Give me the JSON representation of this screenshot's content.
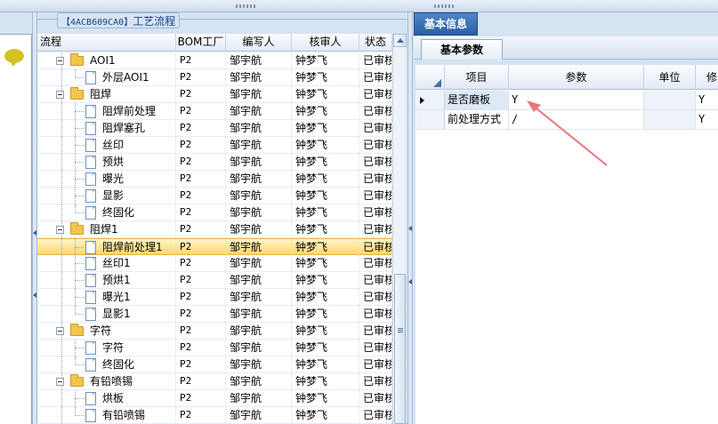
{
  "group": {
    "code": "【4ACB609CA0】",
    "title": "工艺流程"
  },
  "tree_grid": {
    "columns": [
      "流程",
      "BOM工厂",
      "编写人",
      "核审人",
      "状态"
    ],
    "rows": [
      {
        "name": "AOI1",
        "level": 1,
        "type": "folder",
        "factory": "P2",
        "writer": "邹宇航",
        "reviewer": "钟梦飞",
        "status": "已审核"
      },
      {
        "name": "外层AOI1",
        "level": 2,
        "type": "doc",
        "factory": "P2",
        "writer": "邹宇航",
        "reviewer": "钟梦飞",
        "status": "已审核"
      },
      {
        "name": "阻焊",
        "level": 1,
        "type": "folder",
        "factory": "P2",
        "writer": "邹宇航",
        "reviewer": "钟梦飞",
        "status": "已审核"
      },
      {
        "name": "阻焊前处理",
        "level": 2,
        "type": "doc",
        "factory": "P2",
        "writer": "邹宇航",
        "reviewer": "钟梦飞",
        "status": "已审核"
      },
      {
        "name": "阻焊塞孔",
        "level": 2,
        "type": "doc",
        "factory": "P2",
        "writer": "邹宇航",
        "reviewer": "钟梦飞",
        "status": "已审核"
      },
      {
        "name": "丝印",
        "level": 2,
        "type": "doc",
        "factory": "P2",
        "writer": "邹宇航",
        "reviewer": "钟梦飞",
        "status": "已审核"
      },
      {
        "name": "预烘",
        "level": 2,
        "type": "doc",
        "factory": "P2",
        "writer": "邹宇航",
        "reviewer": "钟梦飞",
        "status": "已审核"
      },
      {
        "name": "曝光",
        "level": 2,
        "type": "doc",
        "factory": "P2",
        "writer": "邹宇航",
        "reviewer": "钟梦飞",
        "status": "已审核"
      },
      {
        "name": "显影",
        "level": 2,
        "type": "doc",
        "factory": "P2",
        "writer": "邹宇航",
        "reviewer": "钟梦飞",
        "status": "已审核"
      },
      {
        "name": "终固化",
        "level": 2,
        "type": "doc",
        "factory": "P2",
        "writer": "邹宇航",
        "reviewer": "钟梦飞",
        "status": "已审核"
      },
      {
        "name": "阻焊1",
        "level": 1,
        "type": "folder",
        "factory": "P2",
        "writer": "邹宇航",
        "reviewer": "钟梦飞",
        "status": "已审核"
      },
      {
        "name": "阻焊前处理1",
        "level": 2,
        "type": "doc",
        "factory": "P2",
        "writer": "邹宇航",
        "reviewer": "钟梦飞",
        "status": "已审核",
        "selected": true
      },
      {
        "name": "丝印1",
        "level": 2,
        "type": "doc",
        "factory": "P2",
        "writer": "邹宇航",
        "reviewer": "钟梦飞",
        "status": "已审核"
      },
      {
        "name": "预烘1",
        "level": 2,
        "type": "doc",
        "factory": "P2",
        "writer": "邹宇航",
        "reviewer": "钟梦飞",
        "status": "已审核"
      },
      {
        "name": "曝光1",
        "level": 2,
        "type": "doc",
        "factory": "P2",
        "writer": "邹宇航",
        "reviewer": "钟梦飞",
        "status": "已审核"
      },
      {
        "name": "显影1",
        "level": 2,
        "type": "doc",
        "factory": "P2",
        "writer": "邹宇航",
        "reviewer": "钟梦飞",
        "status": "已审核"
      },
      {
        "name": "字符",
        "level": 1,
        "type": "folder",
        "factory": "P2",
        "writer": "邹宇航",
        "reviewer": "钟梦飞",
        "status": "已审核"
      },
      {
        "name": "字符",
        "level": 2,
        "type": "doc",
        "factory": "P2",
        "writer": "邹宇航",
        "reviewer": "钟梦飞",
        "status": "已审核"
      },
      {
        "name": "终固化",
        "level": 2,
        "type": "doc",
        "factory": "P2",
        "writer": "邹宇航",
        "reviewer": "钟梦飞",
        "status": "已审核"
      },
      {
        "name": "有铅喷锡",
        "level": 1,
        "type": "folder",
        "factory": "P2",
        "writer": "邹宇航",
        "reviewer": "钟梦飞",
        "status": "已审核"
      },
      {
        "name": "烘板",
        "level": 2,
        "type": "doc",
        "factory": "P2",
        "writer": "邹宇航",
        "reviewer": "钟梦飞",
        "status": "已审核"
      },
      {
        "name": "有铅喷锡",
        "level": 2,
        "type": "doc",
        "factory": "P2",
        "writer": "邹宇航",
        "reviewer": "钟梦飞",
        "status": "已审核"
      }
    ]
  },
  "right_panel": {
    "tab_label": "基本信息",
    "subtab_label": "基本参数",
    "columns": [
      "项目",
      "参数",
      "单位",
      "修"
    ],
    "rows": [
      {
        "item": "是否磨板",
        "param": "Y",
        "unit": "",
        "flag": "Y",
        "current": true
      },
      {
        "item": "前处理方式",
        "param": "/",
        "unit": "",
        "flag": "Y",
        "current": false
      }
    ]
  },
  "colors": {
    "accent": "#2a5ea6",
    "selection": "#ffd86e",
    "annotation_arrow": "#e8767a",
    "chat_icon": "#d4c224"
  },
  "icons": {
    "left_panel": "chat-bubble-icon",
    "folder": "folder-icon",
    "document": "document-icon"
  }
}
